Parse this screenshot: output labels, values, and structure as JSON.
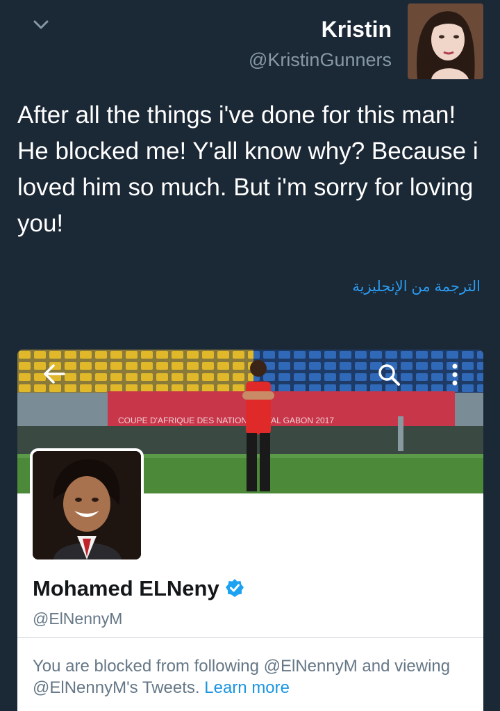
{
  "tweet": {
    "author_name": "Kristin",
    "author_handle": "@KristinGunners",
    "text": "After all the things i've done for this man! He blocked me! Y'all know why? Because i loved him so much. But i'm sorry for loving you!",
    "translate_label": "الترجمة من الإنجليزية"
  },
  "card": {
    "banner_text": "COUPE D'AFRIQUE DES NATIONS TOTAL GABON 2017",
    "profile_name": "Mohamed ELNeny",
    "profile_handle": "@ElNennyM",
    "blocked_text": "You are blocked from following @ElNennyM and viewing @ElNennyM's Tweets.",
    "learn_more": "Learn more"
  },
  "colors": {
    "background": "#1b2836",
    "link": "#2b9bf0",
    "verified": "#1da1f2",
    "secondary_text": "#8899a6"
  },
  "icons": {
    "chevron": "chevron-down-icon",
    "back": "back-arrow-icon",
    "search": "search-icon",
    "more": "more-vertical-icon",
    "verified": "verified-badge-icon"
  }
}
